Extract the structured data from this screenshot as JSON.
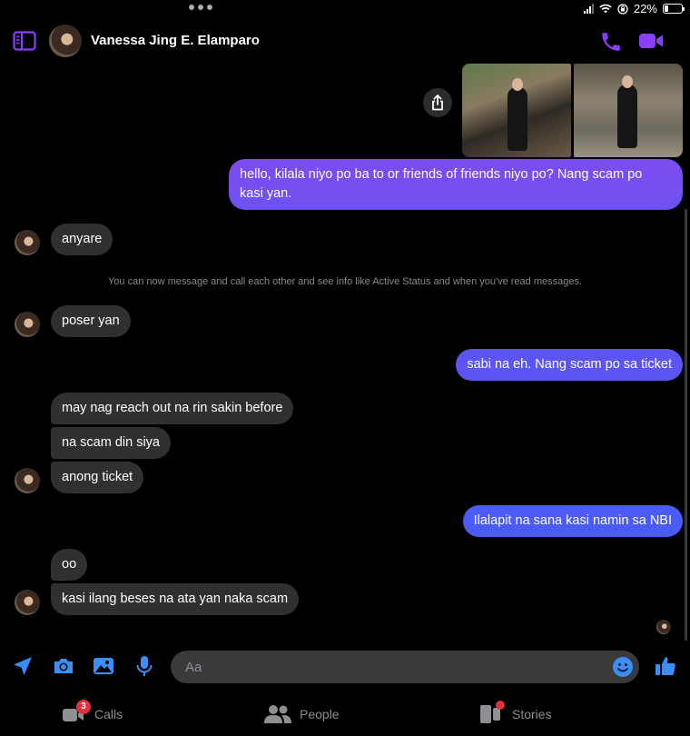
{
  "status_bar": {
    "battery": "22%",
    "battery_level": 0.22
  },
  "header": {
    "contact_name": "Vanessa Jing E. Elamparo"
  },
  "colors": {
    "accent": "#8a3ffc",
    "out_top": "#7b4cf0",
    "out_bottom": "#4a5cf5",
    "incoming": "#303030"
  },
  "messages": [
    {
      "id": "m1",
      "from": "me",
      "text": "hello, kilala niyo po ba to or friends of friends niyo po? Nang scam po",
      "text2": "kasi yan."
    },
    {
      "id": "m2",
      "from": "them",
      "text": "anyare"
    },
    {
      "id": "m3",
      "from": "them",
      "text": "poser yan"
    },
    {
      "id": "m4",
      "from": "me",
      "text": "sabi na eh. Nang scam po sa ticket"
    },
    {
      "id": "m5",
      "from": "them",
      "text": "may nag reach out na rin sakin before"
    },
    {
      "id": "m6",
      "from": "them",
      "text": "na scam din siya"
    },
    {
      "id": "m7",
      "from": "them",
      "text": "anong ticket"
    },
    {
      "id": "m8",
      "from": "me",
      "text": "Ilalapit na sana kasi namin sa NBI"
    },
    {
      "id": "m9",
      "from": "them",
      "text": "oo"
    },
    {
      "id": "m10",
      "from": "them",
      "text": "kasi ilang beses na ata yan naka scam"
    }
  ],
  "system_notice": "You can now message and call each other and see info like Active Status and when you've read messages.",
  "composer": {
    "placeholder": "Aa"
  },
  "tabs": [
    {
      "label": "Calls",
      "badge": "3",
      "icon": "video-call-icon"
    },
    {
      "label": "People",
      "icon": "people-icon"
    },
    {
      "label": "Stories",
      "icon": "stories-icon"
    }
  ]
}
